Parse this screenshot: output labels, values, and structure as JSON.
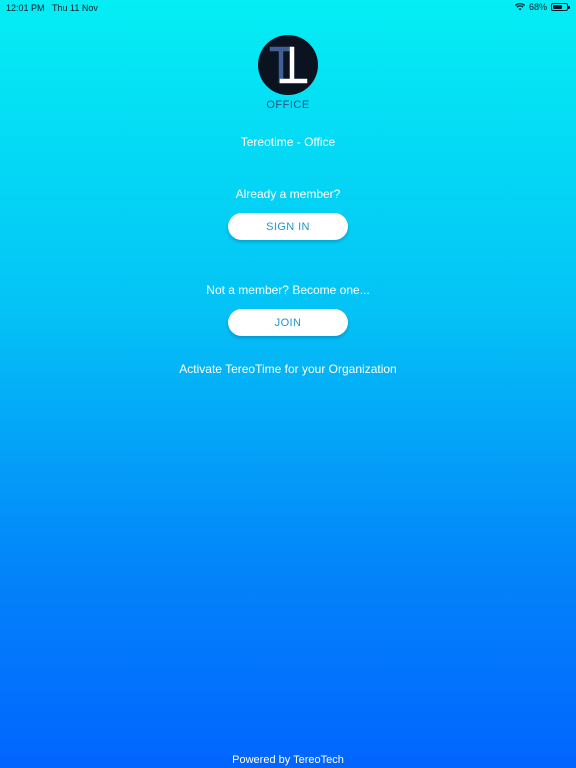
{
  "status_bar": {
    "time": "12:01 PM",
    "date": "Thu 11 Nov",
    "battery": "68%",
    "battery_level": 0.68
  },
  "logo": {
    "mark": "TT",
    "caption": "OFFICE"
  },
  "app_title": "Tereotime - Office",
  "signin": {
    "prompt": "Already a member?",
    "button_label": "SIGN IN"
  },
  "join": {
    "prompt": "Not a member? Become one...",
    "button_label": "JOIN"
  },
  "activate_link": "Activate TereoTime for your Organization",
  "footer": "Powered by TereoTech",
  "colors": {
    "gradient_top": "#05eef4",
    "gradient_bottom": "#0265fe",
    "button_text": "#1d97c9",
    "logo_caption": "#2b4f86"
  }
}
